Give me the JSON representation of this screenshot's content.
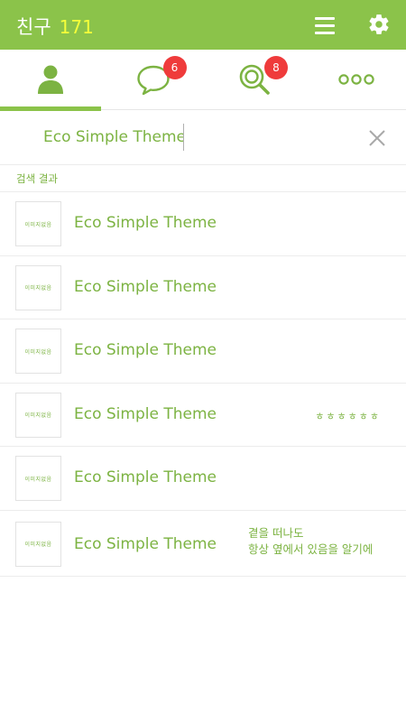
{
  "header": {
    "title": "친구",
    "friend_count": "171",
    "icons": [
      "menu-icon",
      "gear-icon"
    ]
  },
  "tabs": [
    {
      "name": "friends",
      "icon": "person-icon",
      "selected": true
    },
    {
      "name": "chats",
      "icon": "speech-bubble-icon",
      "badge": "6"
    },
    {
      "name": "search",
      "icon": "magnifier-icon",
      "badge": "8"
    },
    {
      "name": "more",
      "icon": "more-icon"
    }
  ],
  "search": {
    "value": "Eco Simple Theme"
  },
  "results": {
    "section_label": "검색 결과",
    "items": [
      {
        "thumb": "이미지없음",
        "title": "Eco Simple Theme",
        "status": ""
      },
      {
        "thumb": "이미지없음",
        "title": "Eco Simple Theme",
        "status": ""
      },
      {
        "thumb": "이미지없음",
        "title": "Eco Simple Theme",
        "status": ""
      },
      {
        "thumb": "이미지없음",
        "title": "Eco Simple Theme",
        "status": "ㅎㅎㅎㅎㅎㅎ"
      },
      {
        "thumb": "이미지없음",
        "title": "Eco Simple Theme",
        "status": ""
      },
      {
        "thumb": "이미지없음",
        "title": "Eco Simple Theme",
        "status": "곁을 떠나도\n항상 옆에서 있음을 알기에"
      }
    ]
  },
  "colors": {
    "accent": "#8bc34a",
    "text_green": "#7cb342",
    "count_yellow": "#f4ff3a",
    "badge_red": "#ef3b3b"
  }
}
